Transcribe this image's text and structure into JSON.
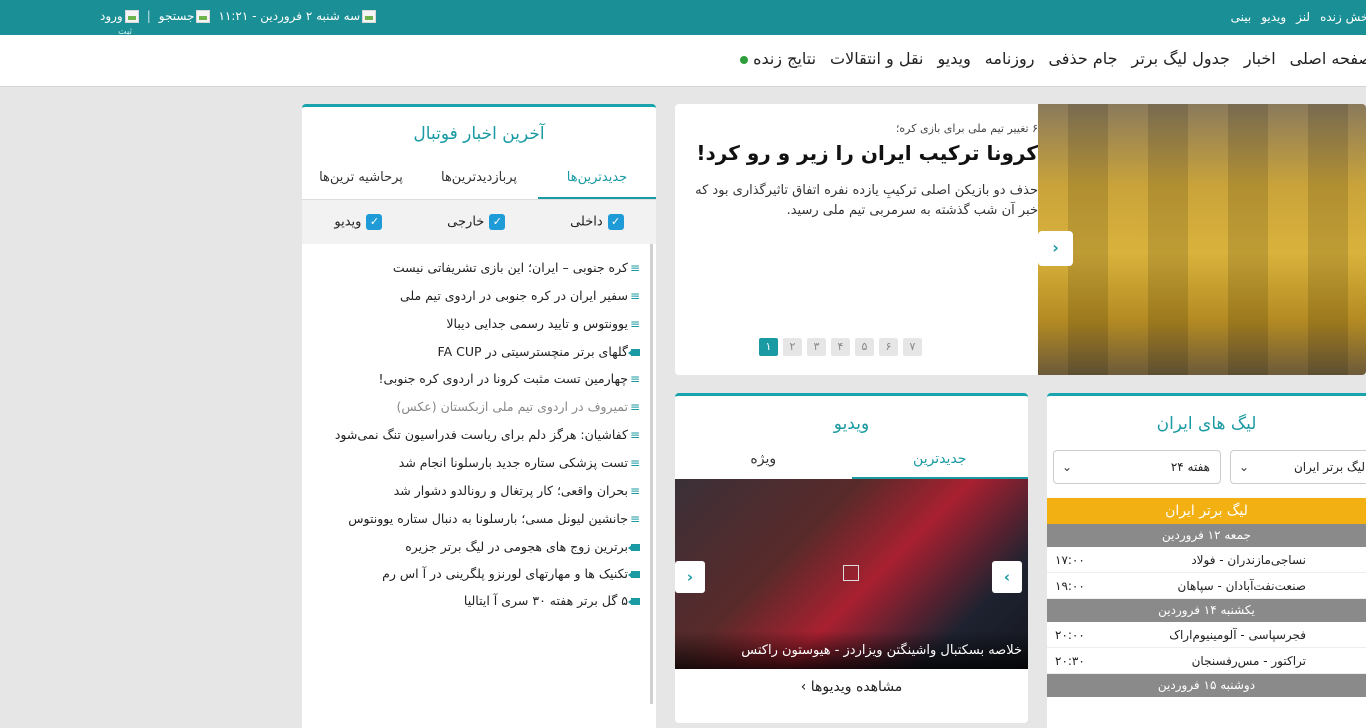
{
  "topbar": {
    "right_links": [
      "پخش زنده",
      "لنز",
      "ویدیو",
      "بینی"
    ],
    "date_time": "سه شنبه ۲ فروردین - ۱۱:۲۱",
    "search": "جستجو",
    "login": "ورود",
    "login_sub": "ثبت"
  },
  "nav": {
    "items": [
      "صفحه اصلی",
      "اخبار",
      "جدول لیگ برتر",
      "جام حذفی",
      "روزنامه",
      "ویدیو",
      "نقل و انتقالات",
      "نتایج زنده"
    ]
  },
  "news": {
    "title": "آخرین اخبار فوتبال",
    "tabs": [
      "جدیدترین‌ها",
      "پربازدیدترین‌ها",
      "پرحاشیه ترین‌ها"
    ],
    "filters": [
      "داخلی",
      "خارجی",
      "ویدیو"
    ],
    "items": [
      {
        "text": "کره جنوبی – ایران؛ این بازی تشریفاتی نیست",
        "type": "text"
      },
      {
        "text": "سفیر ایران در کره جنوبی در اردوی تیم ملی",
        "type": "text"
      },
      {
        "text": "یوونتوس و تایید رسمی جدایی دیبالا",
        "type": "text"
      },
      {
        "text": "گلهای برتر منچسترسیتی در FA CUP",
        "type": "video"
      },
      {
        "text": "چهارمین تست مثبت کرونا در اردوی کره جنوبی!",
        "type": "text"
      },
      {
        "text": "تمیروف در اردوی تیم ملی ازبکستان (عکس)",
        "type": "text",
        "gray": true
      },
      {
        "text": "کفاشیان: هرگز دلم برای ریاست فدراسیون تنگ نمی‌شود",
        "type": "text"
      },
      {
        "text": "تست پزشکی ستاره جدید بارسلونا انجام شد",
        "type": "text"
      },
      {
        "text": "بحران واقعی؛ کار پرتغال و رونالدو دشوار شد",
        "type": "text"
      },
      {
        "text": "جانشین لیونل مسی؛ بارسلونا به دنبال ستاره یوونتوس",
        "type": "text"
      },
      {
        "text": "برترین زوج های هجومی در لیگ برتر جزیره",
        "type": "video"
      },
      {
        "text": "تکنیک ها و مهارتهای لورنزو پلگرینی در آ اس رم",
        "type": "video"
      },
      {
        "text": "۵ گل برتر هفته ۳۰ سری آ ایتالیا",
        "type": "video"
      }
    ]
  },
  "headline": {
    "supra": "۶ تغییر تیم ملی برای بازی کره؛",
    "title": "کرونا ترکیب ایران را زیر و رو کرد!",
    "lead": "حذف دو بازیکن اصلی ترکیبِ یازده نفره اتفاق تاثیرگذاری بود که خبر آن شب گذشته به سرمربی تیم ملی رسید.",
    "pages": [
      "۱",
      "۲",
      "۳",
      "۴",
      "۵",
      "۶",
      "۷"
    ],
    "active_page": 0
  },
  "video": {
    "title": "ویدیو",
    "tabs": [
      "جدیدترین",
      "ویژه"
    ],
    "caption": "خلاصه بسکتبال واشینگتن ویزاردز - هیوستون راکتس",
    "more": "مشاهده ویدیوها"
  },
  "leagues": {
    "title": "لیگ های ایران",
    "select_league": "لیگ برتر ایران",
    "select_week": "هفته ۲۴",
    "league_name": "لیگ برتر ایران",
    "days": [
      {
        "label": "جمعه ۱۲ فروردین",
        "matches": [
          {
            "home": "نساجی‌مازندران",
            "away": "فولاد",
            "time": "۱۷:۰۰"
          },
          {
            "home": "صنعت‌نفت‌آبادان",
            "away": "سپاهان",
            "time": "۱۹:۰۰"
          }
        ]
      },
      {
        "label": "یکشنبه ۱۴ فروردین",
        "matches": [
          {
            "home": "فجرسپاسی",
            "away": "آلومینیوم‌اراک",
            "time": "۲۰:۰۰"
          },
          {
            "home": "تراکتور",
            "away": "مس‌رفسنجان",
            "time": "۲۰:۳۰"
          }
        ]
      },
      {
        "label": "دوشنبه ۱۵ فروردین",
        "matches": []
      }
    ]
  }
}
